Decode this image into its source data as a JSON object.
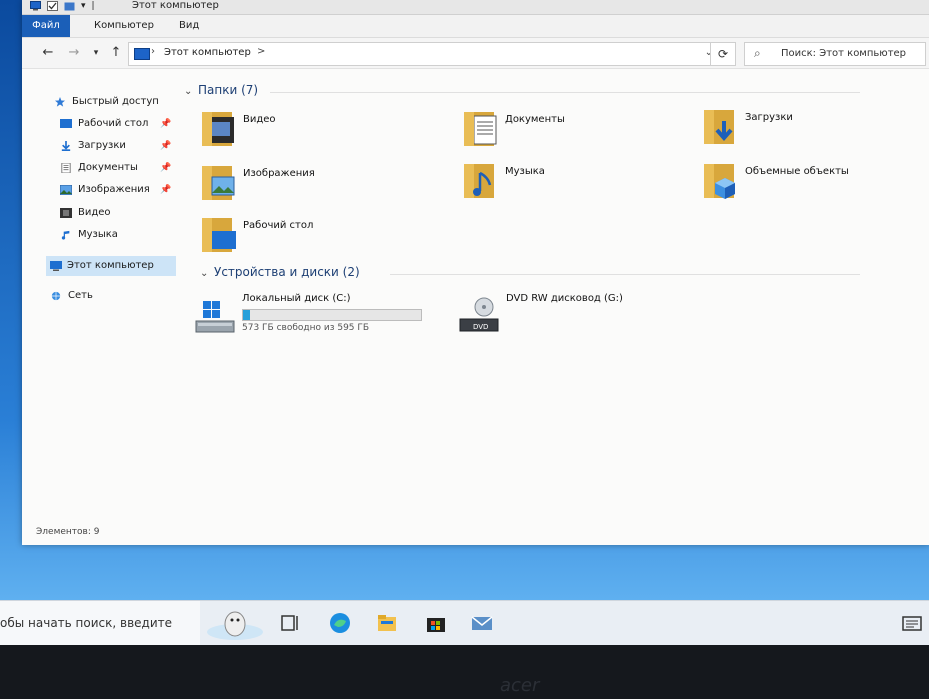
{
  "window": {
    "title": "Этот компьютер",
    "ribbon_tabs": [
      "Файл",
      "Компьютер",
      "Вид"
    ]
  },
  "address": {
    "breadcrumb": "Этот компьютер",
    "separator": ">"
  },
  "search": {
    "placeholder": "Поиск: Этот компьютер"
  },
  "sidebar": {
    "items": [
      {
        "label": "Быстрый доступ",
        "icon": "star-icon"
      },
      {
        "label": "Рабочий стол",
        "icon": "desktop-icon",
        "pinned": true
      },
      {
        "label": "Загрузки",
        "icon": "download-icon",
        "pinned": true
      },
      {
        "label": "Документы",
        "icon": "document-icon",
        "pinned": true
      },
      {
        "label": "Изображения",
        "icon": "pictures-icon",
        "pinned": true
      },
      {
        "label": "Видео",
        "icon": "video-icon"
      },
      {
        "label": "Музыка",
        "icon": "music-icon"
      },
      {
        "label": "Этот компьютер",
        "icon": "computer-icon",
        "selected": true
      },
      {
        "label": "Сеть",
        "icon": "network-icon"
      }
    ]
  },
  "folders_group": {
    "title": "Папки (7)",
    "items": [
      {
        "label": "Видео",
        "icon": "video-folder-icon"
      },
      {
        "label": "Документы",
        "icon": "documents-folder-icon"
      },
      {
        "label": "Загрузки",
        "icon": "downloads-folder-icon"
      },
      {
        "label": "Изображения",
        "icon": "pictures-folder-icon"
      },
      {
        "label": "Музыка",
        "icon": "music-folder-icon"
      },
      {
        "label": "Объемные объекты",
        "icon": "3d-objects-folder-icon"
      },
      {
        "label": "Рабочий стол",
        "icon": "desktop-folder-icon"
      }
    ]
  },
  "devices_group": {
    "title": "Устройства и диски (2)",
    "items": [
      {
        "label": "Локальный диск (C:)",
        "free_text": "573 ГБ свободно из 595 ГБ",
        "used_fraction": 0.037,
        "icon": "hard-drive-icon"
      },
      {
        "label": "DVD RW дисковод (G:)",
        "icon": "dvd-drive-icon",
        "badge": "DVD"
      }
    ]
  },
  "status": {
    "items_count": "Элементов: 9"
  },
  "taskbar": {
    "search_text": "обы начать поиск, введите",
    "icons": [
      "task-view-icon",
      "edge-icon",
      "file-explorer-icon",
      "store-icon",
      "mail-icon",
      "notification-icon"
    ]
  },
  "colors": {
    "accent": "#1b5fb8",
    "folder": "#e8b94a",
    "selection": "#cde4f7",
    "progress": "#26a0da"
  }
}
